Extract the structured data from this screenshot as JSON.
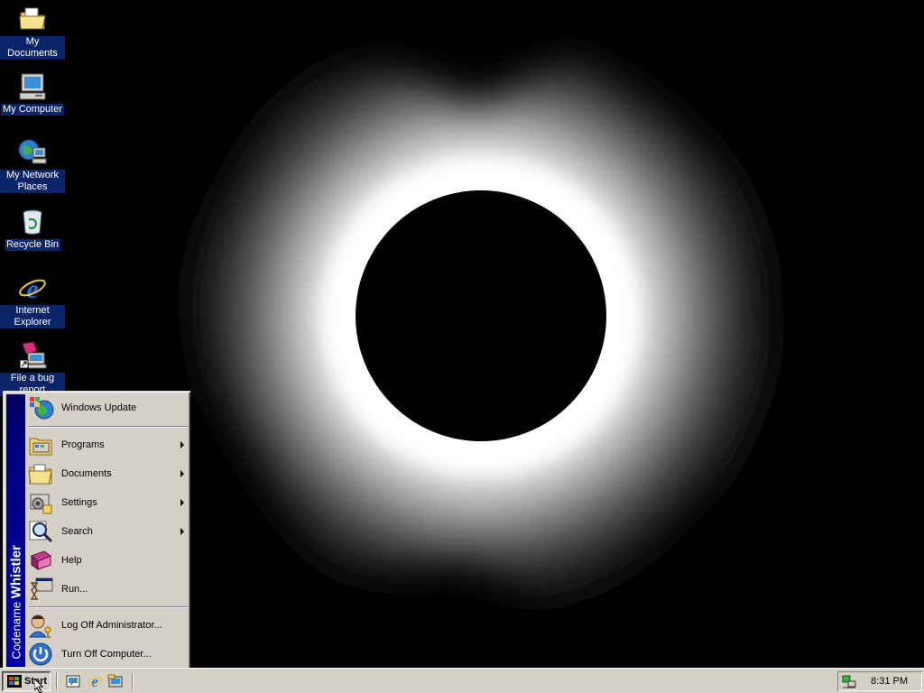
{
  "desktop": {
    "icons": [
      {
        "label": "My Documents",
        "icon": "folder-icon"
      },
      {
        "label": "My Computer",
        "icon": "computer-icon"
      },
      {
        "label": "My Network Places",
        "icon": "network-icon"
      },
      {
        "label": "Recycle Bin",
        "icon": "recycle-bin-icon"
      },
      {
        "label": "Internet Explorer",
        "icon": "ie-icon"
      },
      {
        "label": "File a bug report",
        "icon": "bug-report-icon"
      }
    ]
  },
  "start_menu": {
    "band_prefix": "Codename ",
    "band_name": "Whistler",
    "items": [
      {
        "label": "Windows Update",
        "icon": "windows-update-icon",
        "submenu": false
      },
      {
        "label": "Programs",
        "icon": "programs-icon",
        "submenu": true
      },
      {
        "label": "Documents",
        "icon": "documents-icon",
        "submenu": true
      },
      {
        "label": "Settings",
        "icon": "settings-icon",
        "submenu": true
      },
      {
        "label": "Search",
        "icon": "search-icon",
        "submenu": true
      },
      {
        "label": "Help",
        "icon": "help-icon",
        "submenu": false
      },
      {
        "label": "Run...",
        "icon": "run-icon",
        "submenu": false
      },
      {
        "label": "Log Off Administrator...",
        "icon": "log-off-icon",
        "submenu": false
      },
      {
        "label": "Turn Off Computer...",
        "icon": "power-icon",
        "submenu": false
      }
    ]
  },
  "taskbar": {
    "start_label": "Start",
    "quick_launch": [
      "show-desktop-icon",
      "ie-icon",
      "outlook-icon"
    ],
    "clock": "8:31 PM"
  },
  "colors": {
    "desktop": "#000000",
    "selection": "#0a246a",
    "face": "#d4d0c8",
    "band": "#000080"
  }
}
